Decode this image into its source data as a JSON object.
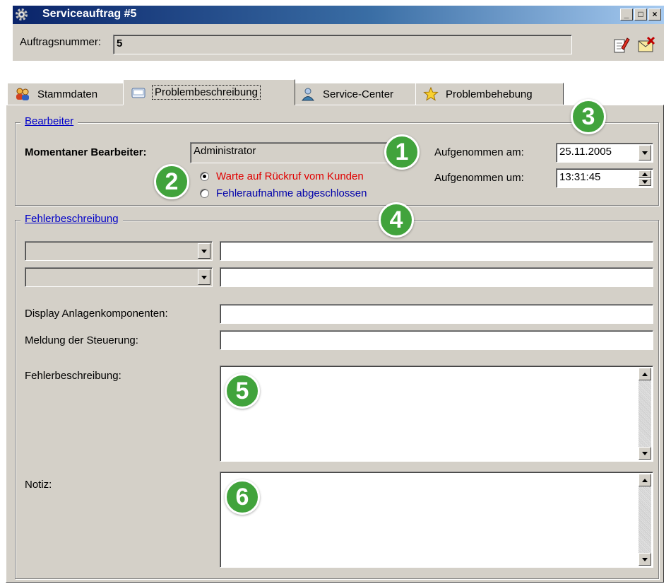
{
  "window": {
    "title": "Serviceauftrag #5",
    "minimize": "_",
    "maximize": "□",
    "close": "×",
    "order_number_label": "Auftragsnummer:",
    "order_number_value": "5"
  },
  "tabs": [
    {
      "label": "Stammdaten",
      "icon": "users-icon"
    },
    {
      "label": "Problembeschreibung",
      "icon": "folder-icon"
    },
    {
      "label": "Service-Center",
      "icon": "service-person-icon"
    },
    {
      "label": "Problembehebung",
      "icon": "star-icon"
    }
  ],
  "active_tab": "Problembeschreibung",
  "bearbeiter": {
    "group_title": "Bearbeiter",
    "current_label": "Momentaner Bearbeiter:",
    "current_value": "Administrator",
    "radio_wait": "Warte auf Rückruf vom Kunden",
    "radio_done": "Fehleraufnahme abgeschlossen",
    "radio_selected": "Warte auf Rückruf vom Kunden",
    "recorded_date_label": "Aufgenommen am:",
    "recorded_date_value": "25.11.2005",
    "recorded_time_label": "Aufgenommen um:",
    "recorded_time_value": "13:31:45"
  },
  "fehler": {
    "group_title": "Fehlerbeschreibung",
    "combo1_value": "",
    "combo2_value": "",
    "text1_value": "",
    "text2_value": "",
    "display_label": "Display Anlagenkomponenten:",
    "display_value": "",
    "meldung_label": "Meldung der Steuerung:",
    "meldung_value": "",
    "beschreibung_label": "Fehlerbeschreibung:",
    "beschreibung_value": "",
    "notiz_label": "Notiz:",
    "notiz_value": ""
  },
  "markers": [
    "1",
    "2",
    "3",
    "4",
    "5",
    "6"
  ],
  "colors": {
    "title_gradient_start": "#0a246a",
    "title_gradient_end": "#a6caf0",
    "dialog_face": "#d4d0c8",
    "group_title_link": "#0000c8",
    "radio_wait_text": "#e00000",
    "radio_done_text": "#0000aa",
    "marker_green": "#41a33c"
  }
}
